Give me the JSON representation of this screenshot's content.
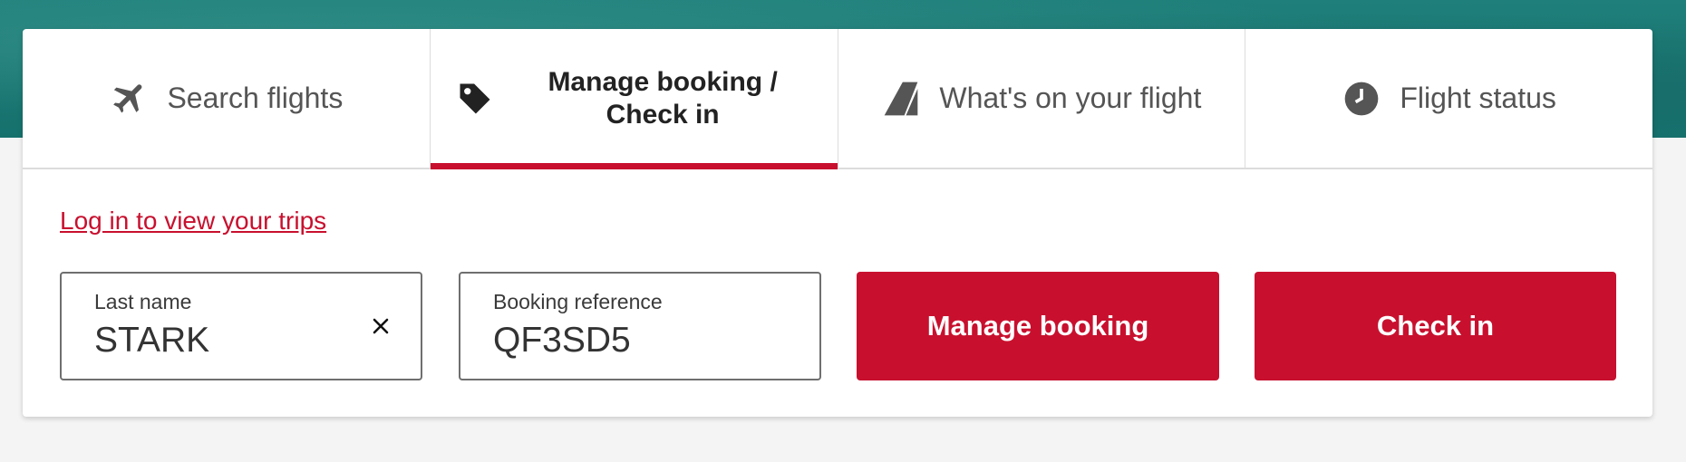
{
  "colors": {
    "accent": "#c8102e",
    "hero_teal": "#1a7a75",
    "tab_text": "#555555"
  },
  "tabs": [
    {
      "label": "Search flights",
      "icon": "plane-icon",
      "active": false
    },
    {
      "label": "Manage booking / Check in",
      "icon": "tag-icon",
      "active": true
    },
    {
      "label": "What's on your flight",
      "icon": "tail-fin-icon",
      "active": false
    },
    {
      "label": "Flight status",
      "icon": "clock-icon",
      "active": false
    }
  ],
  "login_link": "Log in to view your trips",
  "form": {
    "last_name": {
      "label": "Last name",
      "value": "STARK",
      "clear_icon": "close-icon"
    },
    "booking_reference": {
      "label": "Booking reference",
      "value": "QF3SD5"
    },
    "manage_button": "Manage booking",
    "checkin_button": "Check in"
  }
}
